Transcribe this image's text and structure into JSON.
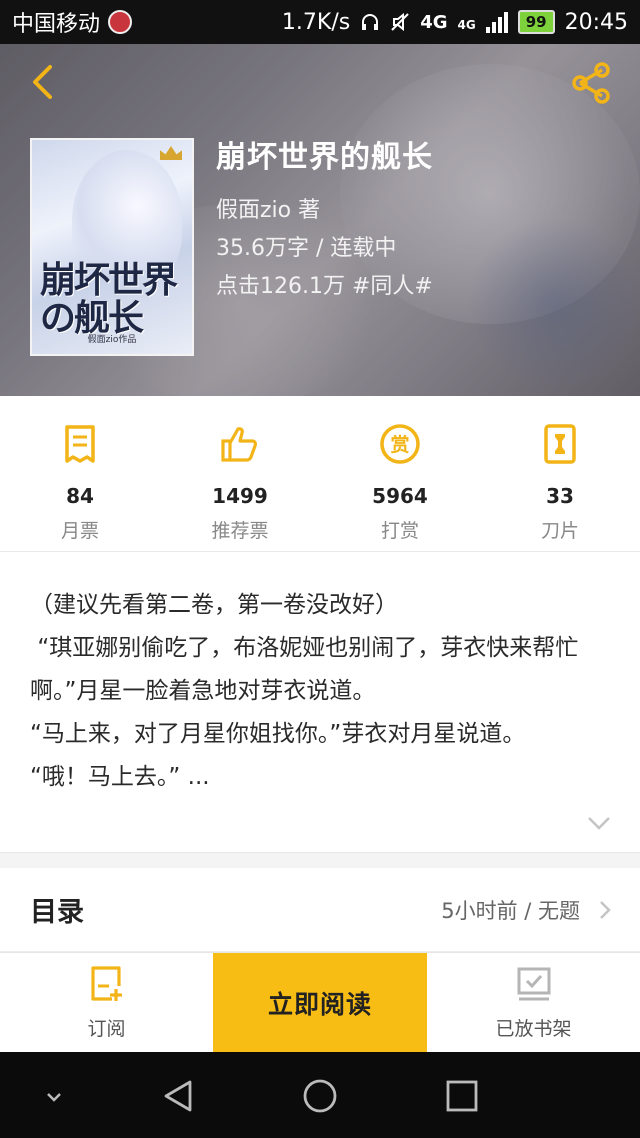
{
  "status_bar": {
    "carrier": "中国移动",
    "speed": "1.7K/s",
    "network": "4G",
    "network_small": "4G",
    "battery": "99",
    "time": "20:45"
  },
  "colors": {
    "accent": "#f8bd15",
    "icon_gold": "#f2b417",
    "muted_icon": "#b5b5b5"
  },
  "header": {
    "back_icon": "chevron-left-icon",
    "share_icon": "share-icon"
  },
  "book": {
    "cover_title": "崩坏世界の舰长",
    "cover_author": "假面zio作品",
    "title": "崩坏世界的舰长",
    "author": "假面zio  著",
    "word_count_status": "35.6万字 / 连载中",
    "clicks_tag": "点击126.1万  #同人#"
  },
  "stats": [
    {
      "icon": "monthly-ticket-icon",
      "value": "84",
      "label": "月票"
    },
    {
      "icon": "thumbs-up-icon",
      "value": "1499",
      "label": "推荐票"
    },
    {
      "icon": "reward-coin-icon",
      "value": "5964",
      "label": "打赏"
    },
    {
      "icon": "blade-card-icon",
      "value": "33",
      "label": "刀片"
    }
  ],
  "description": {
    "line1": "（建议先看第二卷，第一卷没改好）",
    "line2": " “琪亚娜别偷吃了，布洛妮娅也别闹了，芽衣快来帮忙啊。”月星一脸着急地对芽衣说道。",
    "line3": "“马上来，对了月星你姐找你。”芽衣对月星说道。",
    "line4": "“哦！马上去。” ..."
  },
  "catalog": {
    "label": "目录",
    "latest": "5小时前 / 无题"
  },
  "action_bar": {
    "subscribe_label": "订阅",
    "read_now_label": "立即阅读",
    "shelf_label": "已放书架"
  },
  "nav": {
    "collapse_icon": "chevron-down-icon",
    "back_icon": "back-triangle-icon",
    "home_icon": "home-circle-icon",
    "recents_icon": "recents-square-icon"
  }
}
